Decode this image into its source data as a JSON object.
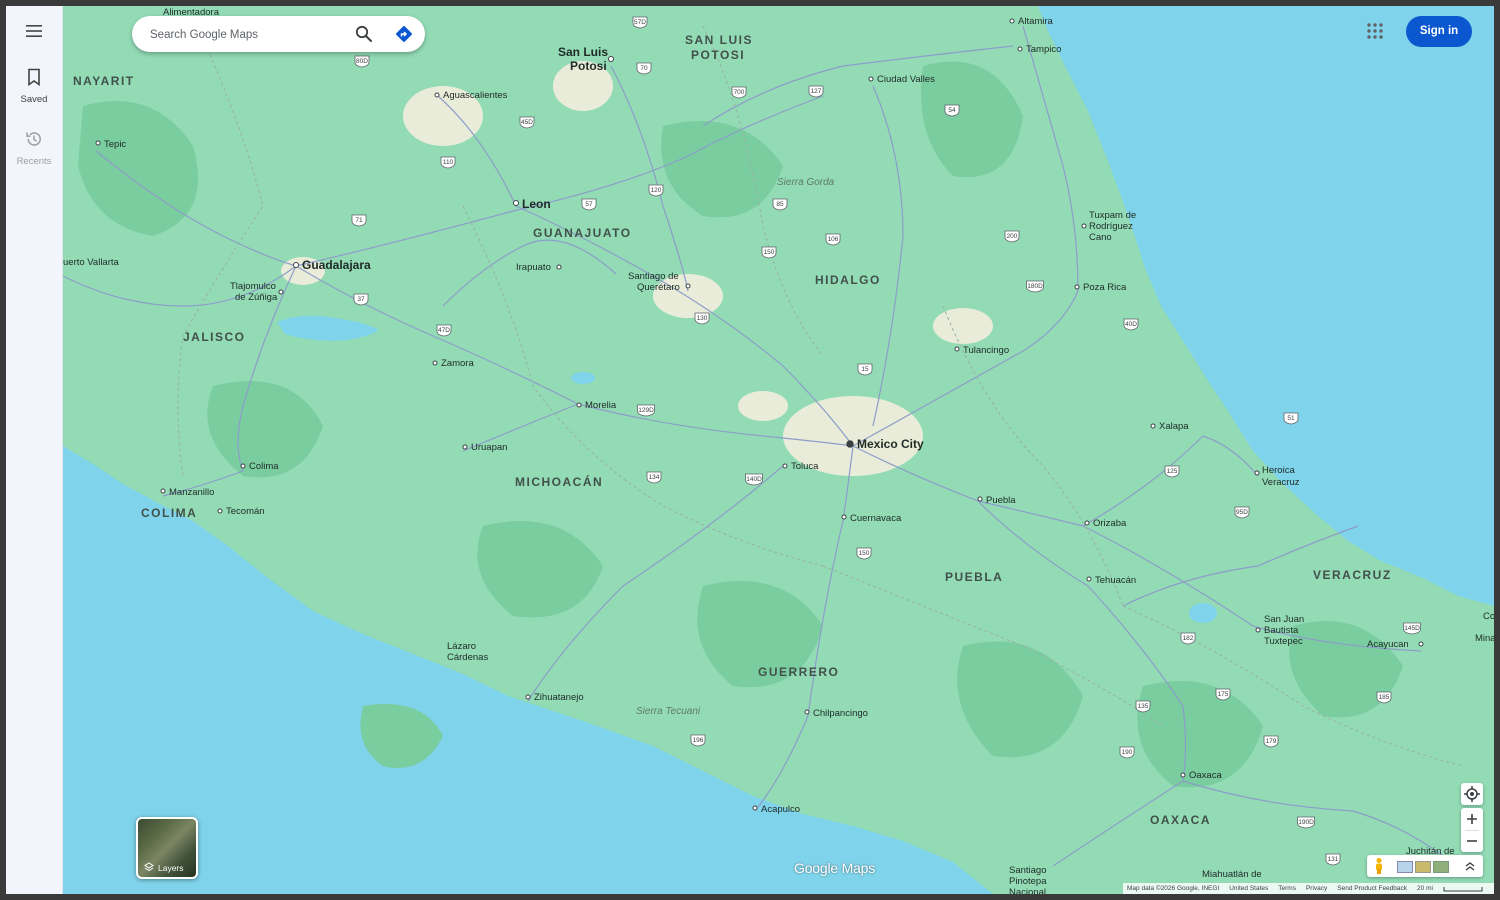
{
  "sidebar": {
    "menu_icon": "hamburger-menu-icon",
    "items": [
      {
        "label": "Saved",
        "icon": "bookmark-icon"
      },
      {
        "label": "Recents",
        "icon": "history-icon"
      }
    ]
  },
  "search": {
    "placeholder": "Search Google Maps",
    "value": "",
    "search_icon": "search-icon",
    "directions_icon": "directions-icon"
  },
  "header": {
    "apps_icon": "google-apps-icon",
    "sign_in_label": "Sign in"
  },
  "map": {
    "region_labels": [
      "NAYARIT",
      "SAN LUIS POTOSI",
      "GUANAJUATO",
      "HIDALGO",
      "JALISCO",
      "MICHOACÁN",
      "COLIMA",
      "PUEBLA",
      "VERACRUZ",
      "GUERRERO",
      "OAXACA"
    ],
    "cities": [
      "Mexico City",
      "Guadalajara",
      "Leon",
      "San Luis Potosi",
      "Aguascalientes",
      "Tepic",
      "Irapuato",
      "Santiago de Querétaro",
      "Morelia",
      "Toluca",
      "Puebla",
      "Cuernavaca",
      "Xalapa",
      "Heroica Veracruz",
      "Oaxaca",
      "Acapulco",
      "Chilpancingo",
      "Zihuatanejo",
      "Colima",
      "Manzanillo",
      "Uruapan",
      "Zamora",
      "Tampico",
      "Poza Rica",
      "Tulancingo",
      "Orizaba",
      "Tehuacán",
      "Ciudad Valles",
      "Altamira",
      "Tecomán",
      "Tlajomulco de Zúñiga",
      "Lázaro Cárdenas",
      "Tuxpam de Rodríguez Cano",
      "San Juan Bautista Tuxtepec",
      "Acayucan",
      "Juchitán de",
      "Miahuatlán de",
      "Santiago Pinotepa Nacional",
      "uerto Vallarta",
      "Alimentadora",
      "Minat",
      "Co"
    ],
    "features": [
      "Sierra Gorda",
      "Sierra Tecuani"
    ],
    "route_shields": [
      "57D",
      "70",
      "700",
      "127",
      "54",
      "80D",
      "45D",
      "110",
      "57",
      "120",
      "85",
      "106",
      "200",
      "150",
      "37",
      "47D",
      "130",
      "180D",
      "40D",
      "15",
      "129D",
      "51",
      "134",
      "140D",
      "125",
      "150",
      "95D",
      "182",
      "145D",
      "175",
      "185",
      "135",
      "190",
      "196",
      "179",
      "190D",
      "131",
      "71"
    ],
    "colors": {
      "water": "#7fd3ea",
      "land": "#92dbb5",
      "forest": "#7acd9f",
      "urban": "#e9ecd8",
      "road": "#8d9dc9"
    }
  },
  "controls": {
    "layers_label": "Layers",
    "layers_icon": "layers-icon",
    "location_icon": "my-location-icon",
    "zoom_in_icon": "zoom-in-icon",
    "zoom_out_icon": "zoom-out-icon",
    "pegman_icon": "street-view-pegman-icon",
    "expand_icon": "expand-up-icon"
  },
  "watermark": "Google Maps",
  "footer": {
    "attribution": "Map data ©2026 Google, INEGI",
    "country": "United States",
    "terms": "Terms",
    "privacy": "Privacy",
    "feedback": "Send Product Feedback",
    "scale": "20 mi"
  }
}
